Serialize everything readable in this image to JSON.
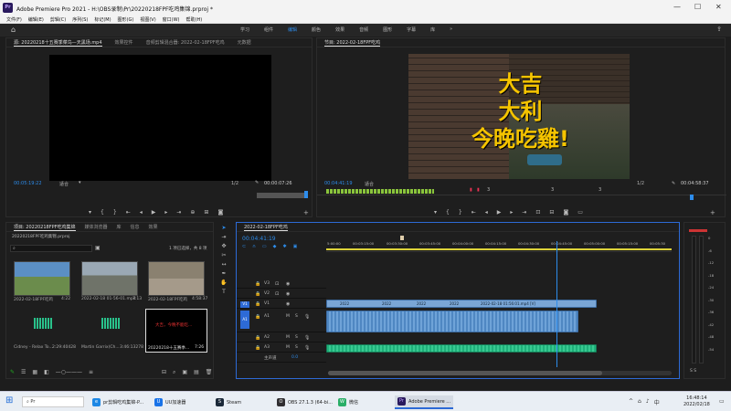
{
  "window": {
    "title": "Adobe Premiere Pro 2021 - H:\\OBS录制\\Pr\\20220218FPF吃鸡集锦.prproj *",
    "logo": "Pr"
  },
  "menu": [
    "文件(F)",
    "编辑(E)",
    "剪辑(C)",
    "序列(S)",
    "标记(M)",
    "图形(G)",
    "视图(V)",
    "窗口(W)",
    "帮助(H)"
  ],
  "workspaces": {
    "tabs": [
      "学习",
      "组件",
      "编辑",
      "颜色",
      "效果",
      "音频",
      "图形",
      "字幕",
      "库"
    ],
    "active": "编辑",
    "more": "»"
  },
  "source_panel": {
    "tabs": [
      "源: 20220218十五赛季菜鸟—天黑场.mp4",
      "效果控件",
      "音频剪辑混合器: 2022-02-18FPF吃鸡",
      "元数据"
    ],
    "timecode_left": "00:05:19:22",
    "fit": "适合",
    "quality": "1/2",
    "timecode_right": "00:00:07:26"
  },
  "program_panel": {
    "tab": "节目: 2022-02-18FPF吃鸡",
    "overlay": [
      "大吉",
      "大利",
      "今晚吃雞!"
    ],
    "timecode_left": "00:04:41:19",
    "fit": "适合",
    "quality": "1/2",
    "timecode_right": "00:04:58:37",
    "ruler_ticks": [
      "3",
      "3",
      "3"
    ]
  },
  "project_panel": {
    "tabs": [
      "项目: 20220218FPF吃鸡集锦",
      "媒体浏览器",
      "库",
      "信息",
      "效果"
    ],
    "file": "20220218FPF吃鸡集锦.prproj",
    "selection": "1 项已选择，共 8 项",
    "items": [
      {
        "name": "2022-02-18FPF吃鸡",
        "duration": "4:22"
      },
      {
        "name": "2022-02-18 01-56-01.mp4",
        "duration": "7:13"
      },
      {
        "name": "2022-02-18FPF吃鸡",
        "duration": "4:58:37"
      },
      {
        "name": "Cidney - Relax To...",
        "duration": "2:29:40428"
      },
      {
        "name": "Martin Garrix(Ch...",
        "duration": "3:46:13278"
      },
      {
        "name": "20220218十五赛季...",
        "duration": "7:26"
      }
    ],
    "card_text": "大吉，今晚不能吃..."
  },
  "timeline_panel": {
    "tab": "2022-02-18FPF吃鸡",
    "timecode": "00:04:41:19",
    "ruler": [
      "5:00:00",
      "00:03:15:00",
      "00:03:30:00",
      "00:03:45:00",
      "00:04:00:00",
      "00:04:15:00",
      "00:04:30:00",
      "00:04:45:00",
      "00:05:00:00",
      "00:05:15:00",
      "00:05:30"
    ],
    "video_tracks": [
      "V3",
      "V2",
      "V1"
    ],
    "audio_tracks": [
      "A1",
      "A2",
      "A3"
    ],
    "src_v": "V1",
    "src_a": "A1",
    "v1_clip_labels": [
      "2022",
      "2022",
      "2022",
      "2022",
      "2022-02-18 01:56:01.mp4 [V]"
    ],
    "master": "主声道",
    "master_val": "0.0"
  },
  "audio_meter": {
    "labels": [
      "0",
      "-6",
      "-12",
      "-18",
      "-24",
      "-30",
      "-36",
      "-42",
      "-48",
      "-54"
    ],
    "bottom": "S  S"
  },
  "taskbar": {
    "items": [
      {
        "label": "pr剪辑吃鸡集锦-P...",
        "color": "#1e88e5",
        "icon": "e"
      },
      {
        "label": "UU加速器",
        "color": "#1a73e8",
        "icon": "U"
      },
      {
        "label": "Steam",
        "color": "#1b2838",
        "icon": "S"
      },
      {
        "label": "OBS 27.1.3 (64-bi...",
        "color": "#302e31",
        "icon": "O"
      },
      {
        "label": "微信",
        "color": "#2aae67",
        "icon": "W"
      },
      {
        "label": "Adobe Premiere ...",
        "color": "#2a1a5e",
        "icon": "Pr"
      }
    ],
    "tray": "中",
    "time": "16:48:14",
    "date": "2022/02/18"
  }
}
